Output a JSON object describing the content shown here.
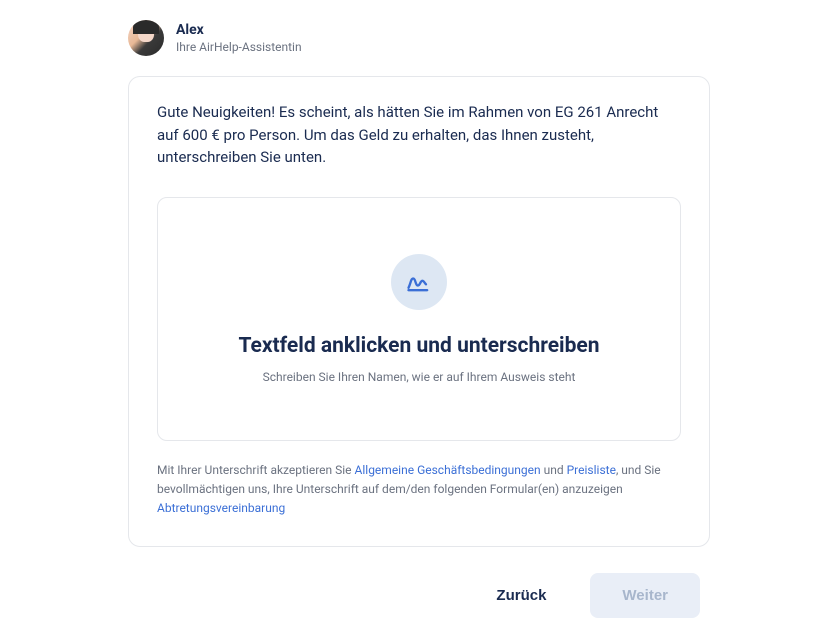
{
  "assistant": {
    "name": "Alex",
    "role": "Ihre AirHelp-Assistentin"
  },
  "message": "Gute Neuigkeiten! Es scheint, als hätten Sie im Rahmen von EG 261 Anrecht auf 600 € pro Person. Um das Geld zu erhalten, das Ihnen zusteht, unterschreiben Sie unten.",
  "signature": {
    "title": "Textfeld anklicken und unterschreiben",
    "sub": "Schreiben Sie Ihren Namen, wie er auf Ihrem Ausweis steht"
  },
  "legal": {
    "pre": "Mit Ihrer Unterschrift akzeptieren Sie ",
    "terms": "Allgemeine Geschäftsbedingungen",
    "and": " und ",
    "pricelist": "Preisliste",
    "post": ", und Sie bevollmächtigen uns, Ihre Unterschrift auf dem/den folgenden Formular(en) anzuzeigen",
    "assignment": "Abtretungsvereinbarung"
  },
  "buttons": {
    "back": "Zurück",
    "next": "Weiter"
  }
}
